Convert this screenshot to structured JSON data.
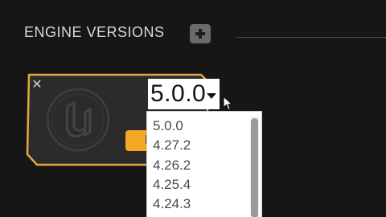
{
  "header": {
    "title": "ENGINE VERSIONS"
  },
  "colors": {
    "accent": "#f5a623",
    "background": "#161616",
    "card_border": "#e2a93a"
  },
  "icons": {
    "add": "plus-icon",
    "close": "close-icon",
    "logo": "unreal-engine-logo-icon",
    "cursor": "mouse-pointer-icon"
  },
  "engine_card": {
    "close_glyph": "✕",
    "launch_label": "L",
    "version_select": {
      "selected": "5.0.0"
    }
  },
  "dropdown": {
    "options": [
      "5.0.0",
      "4.27.2",
      "4.26.2",
      "4.25.4",
      "4.24.3"
    ]
  }
}
